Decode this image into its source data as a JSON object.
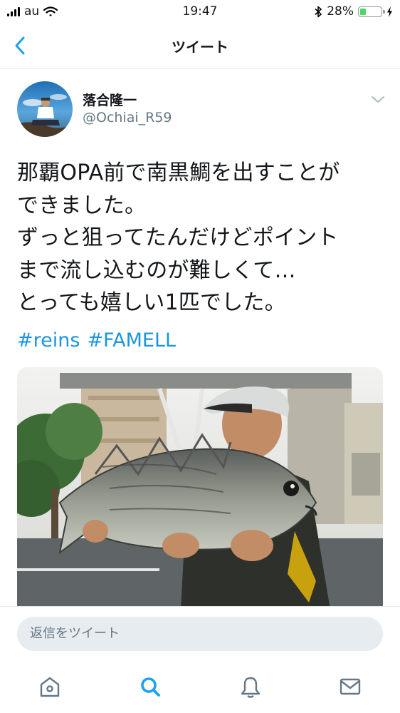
{
  "status_bar": {
    "carrier": "au",
    "time": "19:47",
    "battery_percent": "28%"
  },
  "nav": {
    "title": "ツイート",
    "back_icon": "chevron-left-icon"
  },
  "tweet": {
    "display_name": "落合隆一",
    "handle": "@Ochiai_R59",
    "text_lines": [
      "那覇OPA前で南黒鯛を出すことが",
      "できました。",
      "ずっと狙ってたんだけどポイント",
      "まで流し込むのが難しくて…",
      "とっても嬉しい1匹でした。"
    ],
    "hashtags": [
      "#reins",
      "#FAMELL"
    ]
  },
  "reply": {
    "placeholder": "返信をツイート"
  },
  "tabs": [
    {
      "name": "home",
      "icon": "home-icon",
      "active": false
    },
    {
      "name": "search",
      "icon": "search-icon",
      "active": true
    },
    {
      "name": "notifications",
      "icon": "bell-icon",
      "active": false
    },
    {
      "name": "messages",
      "icon": "mail-icon",
      "active": false
    }
  ],
  "colors": {
    "accent": "#1da1f2",
    "muted": "#657786",
    "battery": "#4cd964"
  }
}
